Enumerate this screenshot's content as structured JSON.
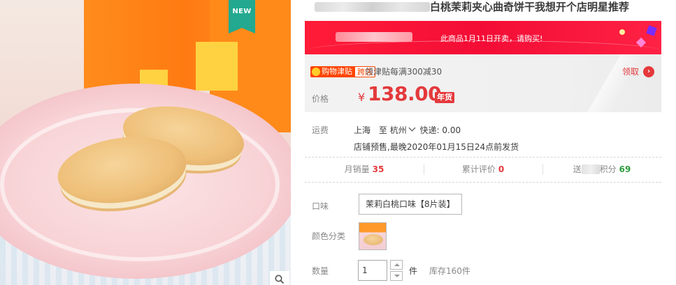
{
  "badge": {
    "new": "NEW"
  },
  "title": {
    "visible": "白桃茉莉夹心曲奇饼干我想开个店明星推荐"
  },
  "promo": {
    "notice": "此商品1月11日开卖，请购买!"
  },
  "jintie": {
    "badge_left": "购物津贴",
    "badge_right": "跨店",
    "text": "领津贴每满300减30",
    "claim": "领取"
  },
  "price": {
    "label": "价格",
    "currency": "¥",
    "value": "138.00",
    "tag": "年货"
  },
  "shipping": {
    "label": "运费",
    "from": "上海",
    "to_prefix": "至",
    "to": "杭州",
    "method": "快递: 0.00",
    "presale": "店铺预售,最晚2020年01月15日24点前发货"
  },
  "stats": {
    "monthly_sales_label": "月销量",
    "monthly_sales": "35",
    "reviews_label": "累计评价",
    "reviews": "0",
    "points_label_prefix": "送",
    "points_label_suffix": "积分",
    "points": "69"
  },
  "options": {
    "flavor_label": "口味",
    "flavor_value": "茉莉白桃口味【8片装】",
    "color_label": "颜色分类",
    "quantity_label": "数量",
    "quantity": "1",
    "unit": "件",
    "stock": "库存160件"
  },
  "icons": {
    "zoom": "magnifier-icon",
    "claim": "chevron-right-icon",
    "location": "chevron-down-icon"
  },
  "colors": {
    "accent_red": "#e4393c",
    "promo_red": "#ff1c38",
    "new_badge": "#22a98f",
    "points_green": "#2c9e3c"
  }
}
